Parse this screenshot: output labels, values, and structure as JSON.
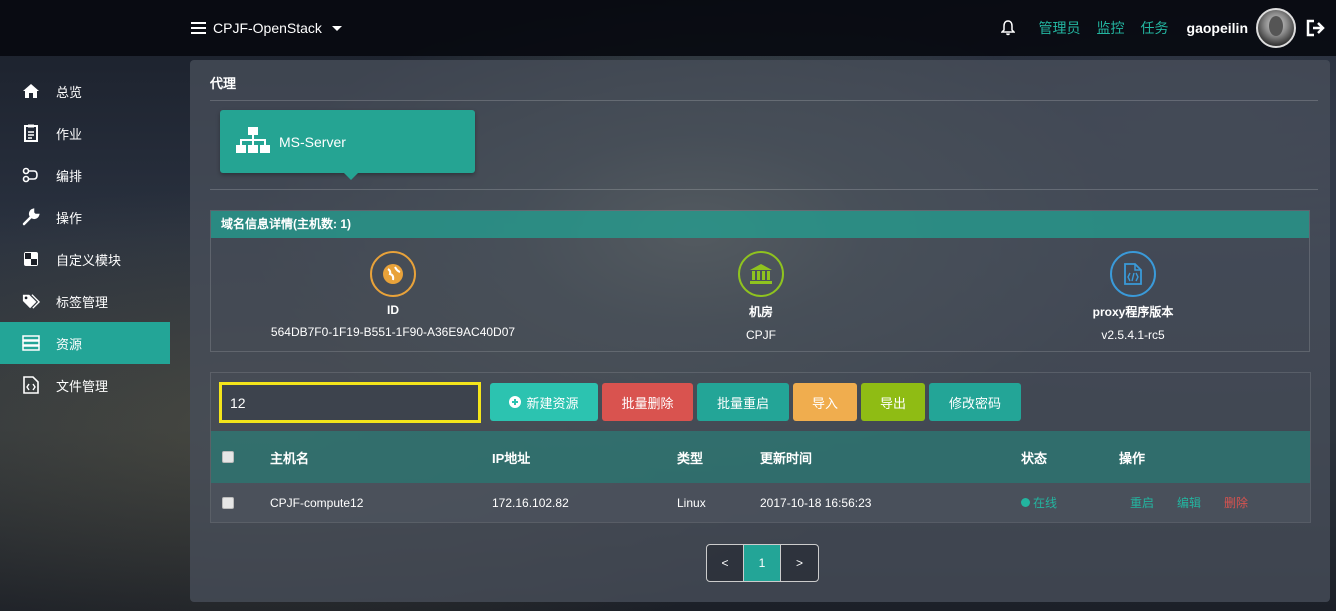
{
  "topbar": {
    "brand": "CPJF-OpenStack",
    "links": [
      "管理员",
      "监控",
      "任务"
    ],
    "username": "gaopeilin",
    "accent": "#23b5a0"
  },
  "sidebar": {
    "items": [
      {
        "label": "总览",
        "icon": "home-icon"
      },
      {
        "label": "作业",
        "icon": "clipboard-icon"
      },
      {
        "label": "编排",
        "icon": "workflow-icon"
      },
      {
        "label": "操作",
        "icon": "wrench-icon"
      },
      {
        "label": "自定义模块",
        "icon": "module-icon"
      },
      {
        "label": "标签管理",
        "icon": "tags-icon"
      },
      {
        "label": "资源",
        "icon": "server-icon",
        "active": true
      },
      {
        "label": "文件管理",
        "icon": "code-file-icon"
      }
    ]
  },
  "panel": {
    "title": "代理",
    "proxy_card": "MS-Server",
    "info": {
      "header": "域名信息详情(主机数: 1)",
      "columns": [
        {
          "key": "ID",
          "value": "564DB7F0-1F19-B551-1F90-A36E9AC40D07",
          "icon": "globe-icon",
          "color": "#e8a23a"
        },
        {
          "key": "机房",
          "value": "CPJF",
          "icon": "bank-icon",
          "color": "#8fc31f"
        },
        {
          "key": "proxy程序版本",
          "value": "v2.5.4.1-rc5",
          "icon": "code-file-icon",
          "color": "#3a9ad9"
        }
      ]
    },
    "resources": {
      "search_value": "12",
      "buttons": [
        {
          "label": "新建资源",
          "color": "#2cc3b0"
        },
        {
          "label": "批量删除",
          "color": "#d9534f"
        },
        {
          "label": "批量重启",
          "color": "#23a597"
        },
        {
          "label": "导入",
          "color": "#f0ad4e"
        },
        {
          "label": "导出",
          "color": "#8fbc14"
        },
        {
          "label": "修改密码",
          "color": "#23a597"
        }
      ],
      "columns": [
        "主机名",
        "IP地址",
        "类型",
        "更新时间",
        "状态",
        "操作"
      ],
      "rows": [
        {
          "hostname": "CPJF-compute12",
          "ip": "172.16.102.82",
          "type": "Linux",
          "updated": "2017-10-18 16:56:23",
          "status": "在线",
          "actions": [
            "重启",
            "编辑",
            "删除"
          ]
        }
      ]
    },
    "pagination": {
      "prev": "<",
      "current": "1",
      "next": ">"
    }
  }
}
